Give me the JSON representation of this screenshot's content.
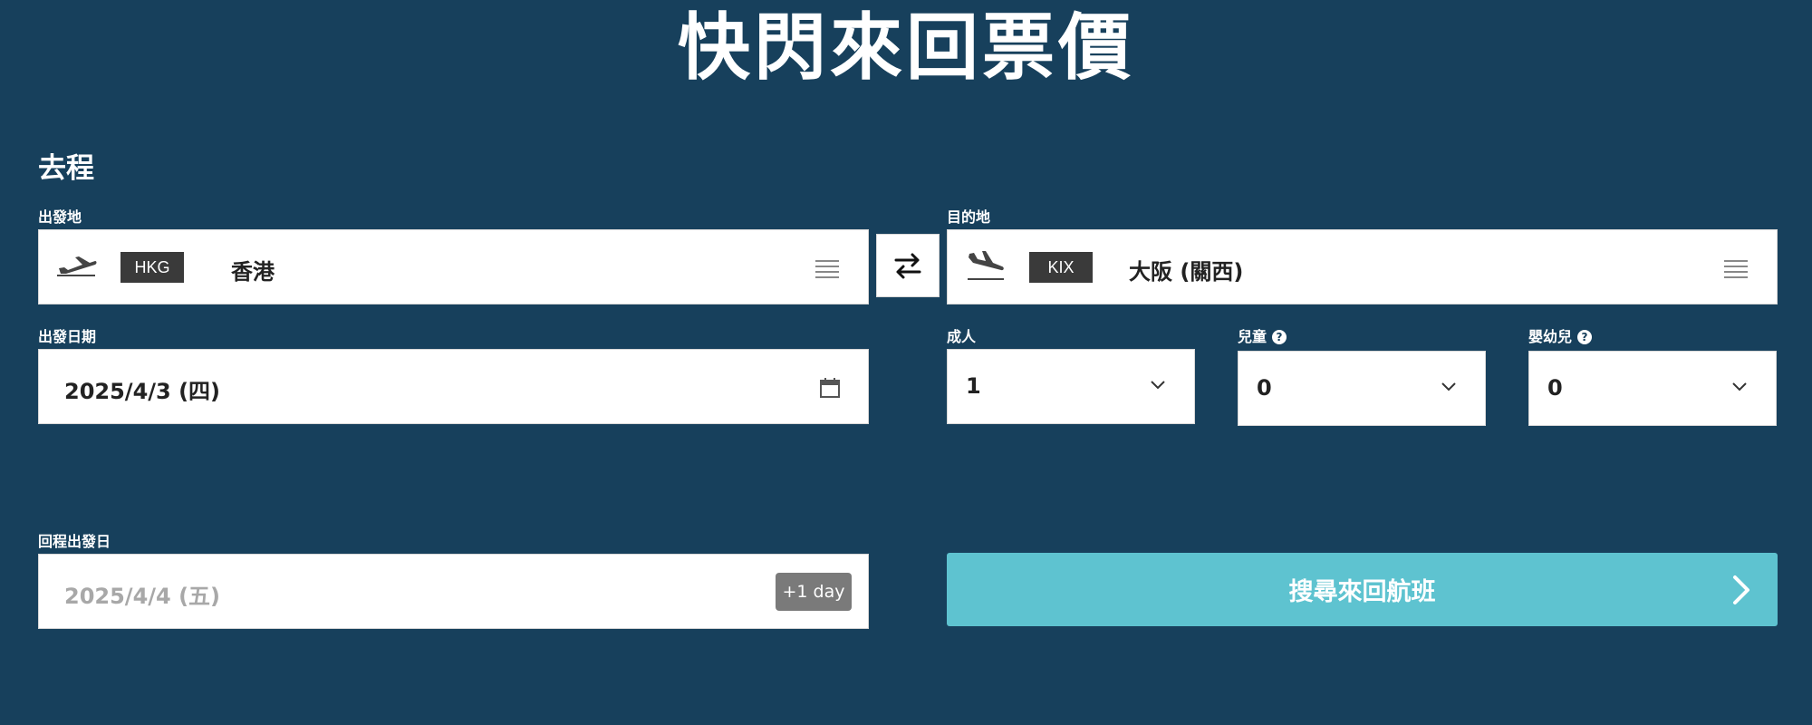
{
  "header": {
    "title": "快閃來回票價"
  },
  "outbound": {
    "section_title": "去程",
    "origin": {
      "label": "出發地",
      "code": "HKG",
      "city": "香港"
    },
    "destination": {
      "label": "目的地",
      "code": "KIX",
      "city": "大阪 (關西)"
    },
    "depart_date": {
      "label": "出發日期",
      "value": "2025/4/3 (四)"
    }
  },
  "passengers": {
    "adults": {
      "label": "成人",
      "value": "1"
    },
    "children": {
      "label": "兒童",
      "value": "0"
    },
    "infants": {
      "label": "嬰幼兒",
      "value": "0"
    }
  },
  "return": {
    "label": "回程出發日",
    "value": "2025/4/4 (五)",
    "offset_badge": "+1 day"
  },
  "search": {
    "label": "搜尋來回航班"
  },
  "icons": {
    "origin": "plane-takeoff-icon",
    "destination": "plane-landing-icon",
    "swap": "swap-arrows-icon",
    "list": "list-icon",
    "calendar": "calendar-icon",
    "dropdown": "chevron-down-icon",
    "help": "question-circle-icon",
    "search_arrow": "chevron-right-icon"
  },
  "colors": {
    "background": "#17405c",
    "search_button": "#5ec3d0",
    "badge": "#3a3a3a"
  }
}
